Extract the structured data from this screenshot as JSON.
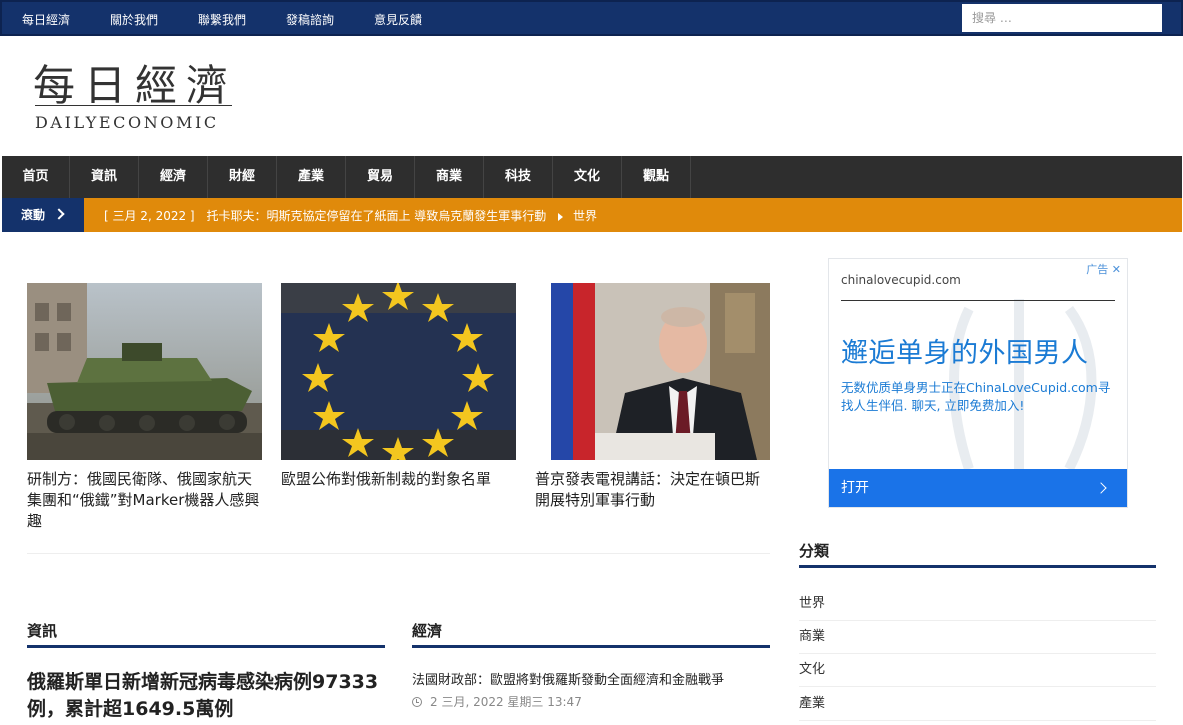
{
  "topbar": {
    "links": [
      "每日經濟",
      "關於我們",
      "聯繫我們",
      "發稿諮詢",
      "意見反饋"
    ],
    "search_placeholder": "搜尋 …"
  },
  "logo": {
    "chinese": "每日經濟",
    "english": "DAILYECONOMIC"
  },
  "nav": [
    "首页",
    "資訊",
    "經濟",
    "財經",
    "產業",
    "貿易",
    "商業",
    "科技",
    "文化",
    "觀點"
  ],
  "ticker": {
    "label": "滾動",
    "date": "[ 三月 2, 2022 ]",
    "headline": "托卡耶夫：明斯克協定停留在了紙面上 導致烏克蘭發生軍事行動",
    "category": "世界"
  },
  "featured": [
    {
      "title": "研制方：俄國民衛隊、俄國家航天集團和“俄鐵”對Marker機器人感興趣",
      "image": "tracked-robot-vehicle"
    },
    {
      "title": "歐盟公佈對俄新制裁的對象名單",
      "image": "eu-stars-flag"
    },
    {
      "title": "普京發表電視講話：決定在頓巴斯開展特別軍事行動",
      "image": "president-address"
    }
  ],
  "sections": {
    "left": {
      "heading": "資訊",
      "headline": "俄羅斯單日新增新冠病毒感染病例97333例，累計超1649.5萬例"
    },
    "right": {
      "heading": "經濟",
      "headline": "法國財政部：歐盟將對俄羅斯發動全面經濟和金融戰爭",
      "meta": "2 三月, 2022 星期三 13:47"
    }
  },
  "ad": {
    "tag": "广告",
    "domain": "chinalovecupid.com",
    "headline": "邂逅单身的外国男人",
    "body": "无数优质单身男士正在ChinaLoveCupid.com寻找人生伴侣. 聊天, 立即免费加入!",
    "cta": "打开",
    "accent": "#1a73e8"
  },
  "categories": {
    "heading": "分類",
    "items": [
      "世界",
      "商業",
      "文化",
      "產業"
    ]
  },
  "colors": {
    "navy": "#14326b",
    "nav_bg": "#2e2e2e",
    "ticker": "#e08a0b"
  }
}
